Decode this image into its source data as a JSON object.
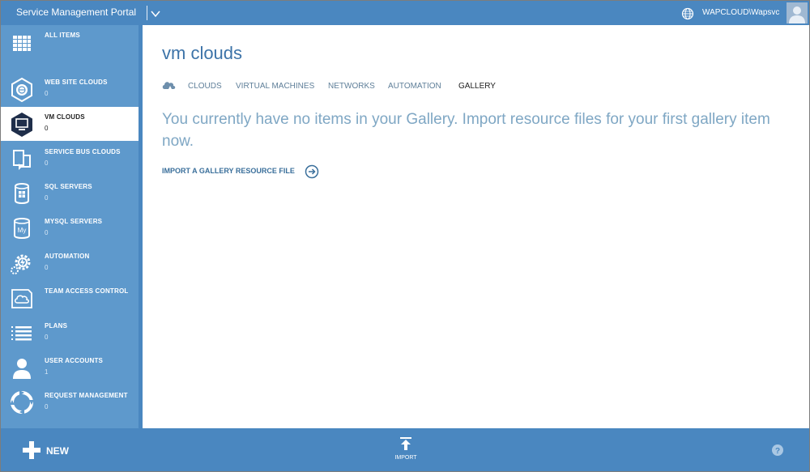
{
  "app": {
    "title": "Service Management Portal",
    "account": "WAPCLOUD\\Wapsvc"
  },
  "sidebar": {
    "items": [
      {
        "label": "ALL ITEMS",
        "count": "",
        "icon": "all-items-grid-icon"
      },
      {
        "label": "WEB SITE CLOUDS",
        "count": "0",
        "icon": "web-site-clouds-icon"
      },
      {
        "label": "VM CLOUDS",
        "count": "0",
        "icon": "vm-clouds-icon",
        "active": true
      },
      {
        "label": "SERVICE BUS CLOUDS",
        "count": "0",
        "icon": "service-bus-icon"
      },
      {
        "label": "SQL SERVERS",
        "count": "0",
        "icon": "sql-servers-icon"
      },
      {
        "label": "MYSQL SERVERS",
        "count": "0",
        "icon": "mysql-servers-icon"
      },
      {
        "label": "AUTOMATION",
        "count": "0",
        "icon": "automation-gear-icon"
      },
      {
        "label": "TEAM ACCESS CONTROL",
        "count": "",
        "icon": "team-access-cloud-icon"
      },
      {
        "label": "PLANS",
        "count": "0",
        "icon": "plans-list-icon"
      },
      {
        "label": "USER ACCOUNTS",
        "count": "1",
        "icon": "user-accounts-icon"
      },
      {
        "label": "REQUEST MANAGEMENT",
        "count": "0",
        "icon": "request-management-icon"
      }
    ]
  },
  "main": {
    "title": "vm clouds",
    "tabs": [
      {
        "label": "CLOUDS"
      },
      {
        "label": "VIRTUAL MACHINES"
      },
      {
        "label": "NETWORKS"
      },
      {
        "label": "AUTOMATION"
      },
      {
        "label": "GALLERY",
        "active": true
      }
    ],
    "empty_message": "You currently have no items in your Gallery. Import resource files for your first gallery item now.",
    "import_link": "IMPORT A GALLERY RESOURCE FILE"
  },
  "bottombar": {
    "new_label": "NEW",
    "import_label": "IMPORT"
  },
  "colors": {
    "accent": "#4a87c0",
    "sidebar": "#5e99cc",
    "title": "#3c73a8",
    "message": "#7fa7c4"
  }
}
